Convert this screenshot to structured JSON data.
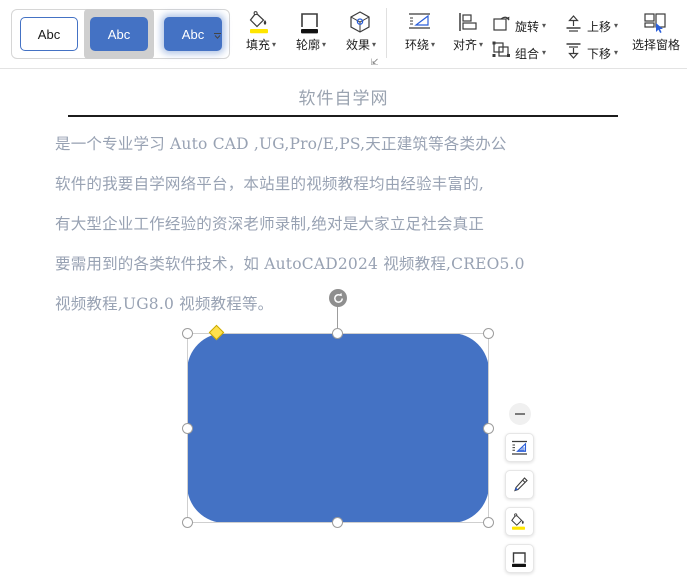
{
  "ribbon": {
    "gallery": {
      "name": "shape-styles-gallery",
      "items": [
        {
          "label": "Abc",
          "state": "normal"
        },
        {
          "label": "Abc",
          "state": "hover"
        },
        {
          "label": "Abc",
          "state": "selected"
        }
      ],
      "more_caret": "▾"
    },
    "buttons": [
      {
        "name": "fill",
        "label": "填充",
        "caret": "▾"
      },
      {
        "name": "outline",
        "label": "轮廓",
        "caret": "▾"
      },
      {
        "name": "effects",
        "label": "效果",
        "caret": "▾"
      },
      {
        "name": "text-wrap",
        "label": "环绕",
        "caret": "▾"
      },
      {
        "name": "align",
        "label": "对齐",
        "caret": "▾"
      },
      {
        "name": "rotate",
        "label": "旋转",
        "caret": "▾"
      },
      {
        "name": "group",
        "label": "组合",
        "caret": "▾"
      },
      {
        "name": "bring-forward",
        "label": "上移",
        "caret": "▾"
      },
      {
        "name": "send-backward",
        "label": "下移",
        "caret": "▾"
      },
      {
        "name": "selection-pane",
        "label": "选择窗格",
        "caret": ""
      }
    ],
    "dialog_launcher": "⇲"
  },
  "document": {
    "title": "软件自学网",
    "lines": [
      "是一个专业学习 Auto CAD ,UG,Pro/E,PS,天正建筑等各类办公",
      "软件的我要自学网络平台，本站里的视频教程均由经验丰富的,",
      "有大型企业工作经验的资深老师录制,绝对是大家立足社会真正",
      "要需用到的各类软件技术，如 AutoCAD2024 视频教程,CREO5.0",
      "视频教程,UG8.0 视频教程等。"
    ],
    "text_color": "#98a2b3",
    "title_color": "#9aa3b0"
  },
  "shape": {
    "name": "rounded-rectangle",
    "fill_color": "#4472C4",
    "adjust_handle_color": "#FFE14D",
    "handle_count": 8,
    "selected": true
  },
  "mini_toolbar": {
    "collapse_label": "—",
    "buttons": [
      {
        "name": "layout-options",
        "label": "布局选项"
      },
      {
        "name": "shape-style",
        "label": "形状样式"
      },
      {
        "name": "shape-fill",
        "label": "填充颜色"
      },
      {
        "name": "shape-outline",
        "label": "轮廓颜色"
      }
    ]
  }
}
